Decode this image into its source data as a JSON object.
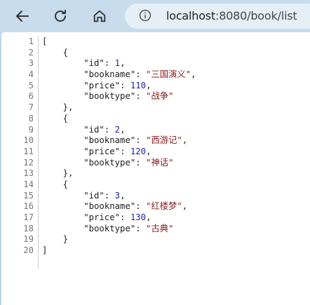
{
  "browser": {
    "url_host": "localhost",
    "url_rest": ":8080/book/list"
  },
  "json_viewer": {
    "lines": [
      {
        "n": "1",
        "parts": [
          [
            "punc",
            "["
          ]
        ]
      },
      {
        "n": "2",
        "parts": [
          [
            "punc",
            "    {"
          ]
        ]
      },
      {
        "n": "3",
        "parts": [
          [
            "key",
            "        \"id\""
          ],
          [
            "punc",
            ": "
          ],
          [
            "num",
            "1"
          ],
          [
            "punc",
            ","
          ]
        ]
      },
      {
        "n": "4",
        "parts": [
          [
            "key",
            "        \"bookname\""
          ],
          [
            "punc",
            ": "
          ],
          [
            "str",
            "\"三国演义\""
          ],
          [
            "punc",
            ","
          ]
        ]
      },
      {
        "n": "5",
        "parts": [
          [
            "key",
            "        \"price\""
          ],
          [
            "punc",
            ": "
          ],
          [
            "num",
            "110"
          ],
          [
            "punc",
            ","
          ]
        ]
      },
      {
        "n": "6",
        "parts": [
          [
            "key",
            "        \"booktype\""
          ],
          [
            "punc",
            ": "
          ],
          [
            "str",
            "\"战争\""
          ]
        ]
      },
      {
        "n": "7",
        "parts": [
          [
            "punc",
            "    },"
          ]
        ]
      },
      {
        "n": "8",
        "parts": [
          [
            "punc",
            "    {"
          ]
        ]
      },
      {
        "n": "9",
        "parts": [
          [
            "key",
            "        \"id\""
          ],
          [
            "punc",
            ": "
          ],
          [
            "num",
            "2"
          ],
          [
            "punc",
            ","
          ]
        ]
      },
      {
        "n": "10",
        "parts": [
          [
            "key",
            "        \"bookname\""
          ],
          [
            "punc",
            ": "
          ],
          [
            "str",
            "\"西游记\""
          ],
          [
            "punc",
            ","
          ]
        ]
      },
      {
        "n": "11",
        "parts": [
          [
            "key",
            "        \"price\""
          ],
          [
            "punc",
            ": "
          ],
          [
            "num",
            "120"
          ],
          [
            "punc",
            ","
          ]
        ]
      },
      {
        "n": "12",
        "parts": [
          [
            "key",
            "        \"booktype\""
          ],
          [
            "punc",
            ": "
          ],
          [
            "str",
            "\"神话\""
          ]
        ]
      },
      {
        "n": "13",
        "parts": [
          [
            "punc",
            "    },"
          ]
        ]
      },
      {
        "n": "14",
        "parts": [
          [
            "punc",
            "    {"
          ]
        ]
      },
      {
        "n": "15",
        "parts": [
          [
            "key",
            "        \"id\""
          ],
          [
            "punc",
            ": "
          ],
          [
            "num",
            "3"
          ],
          [
            "punc",
            ","
          ]
        ]
      },
      {
        "n": "16",
        "parts": [
          [
            "key",
            "        \"bookname\""
          ],
          [
            "punc",
            ": "
          ],
          [
            "str",
            "\"红楼梦\""
          ],
          [
            "punc",
            ","
          ]
        ]
      },
      {
        "n": "17",
        "parts": [
          [
            "key",
            "        \"price\""
          ],
          [
            "punc",
            ": "
          ],
          [
            "num",
            "130"
          ],
          [
            "punc",
            ","
          ]
        ]
      },
      {
        "n": "18",
        "parts": [
          [
            "key",
            "        \"booktype\""
          ],
          [
            "punc",
            ": "
          ],
          [
            "str",
            "\"古典\""
          ]
        ]
      },
      {
        "n": "19",
        "parts": [
          [
            "punc",
            "    }"
          ]
        ]
      },
      {
        "n": "20",
        "parts": [
          [
            "punc",
            "]"
          ]
        ]
      }
    ]
  }
}
